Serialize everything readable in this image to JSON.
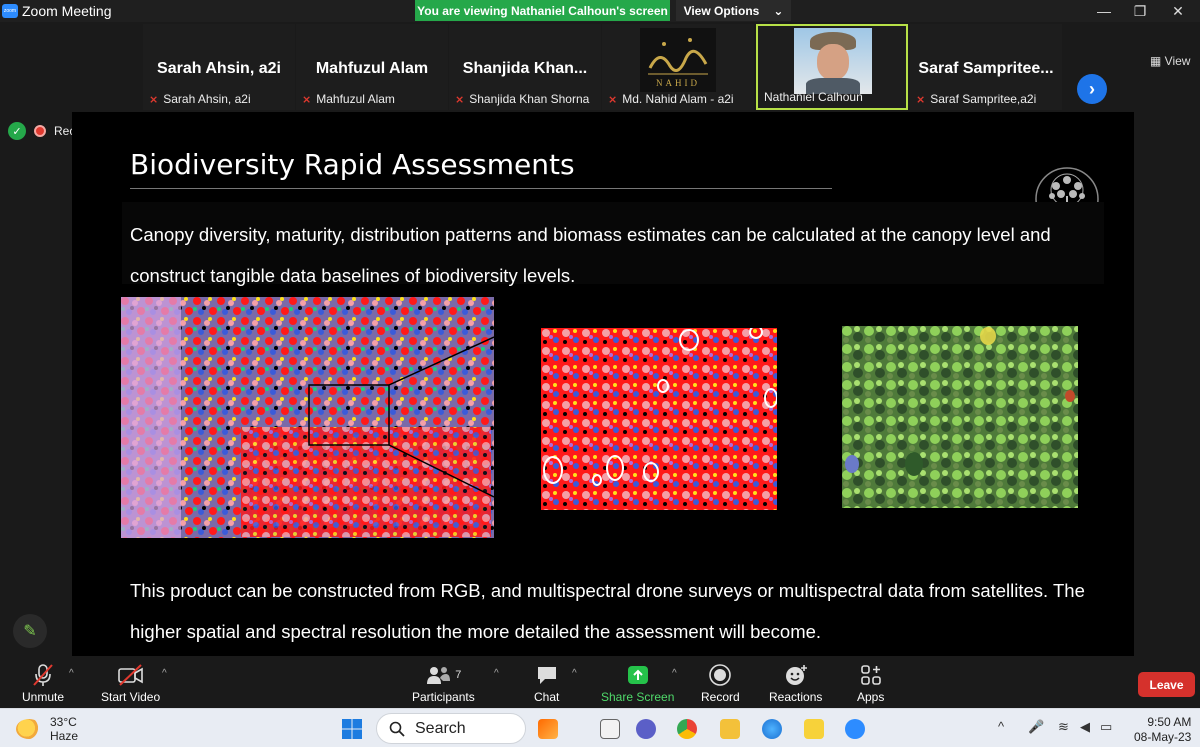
{
  "window": {
    "title": "Zoom Meeting",
    "banner": "You are viewing Nathaniel Calhoun's screen",
    "view_options": "View Options"
  },
  "gallery": {
    "view_label": "View",
    "participants": [
      {
        "display": "Sarah Ahsin, a2i",
        "name": "Sarah Ahsin, a2i",
        "muted": true
      },
      {
        "display": "Mahfuzul Alam",
        "name": "Mahfuzul Alam",
        "muted": true
      },
      {
        "display": "Shanjida  Khan...",
        "name": "Shanjida Khan Shorna",
        "muted": true
      },
      {
        "display": "",
        "name": "Md. Nahid Alam - a2i",
        "muted": true,
        "logo_caption": "NAHID"
      },
      {
        "display": "",
        "name": "Nathaniel Calhoun",
        "muted": false
      },
      {
        "display": "Saraf  Sampritee...",
        "name": "Saraf Sampritee,a2i",
        "muted": true
      }
    ]
  },
  "recording": {
    "label": "Recording"
  },
  "slide": {
    "title": "Biodiversity Rapid Assessments",
    "paragraph1": "Canopy diversity, maturity, distribution patterns and biomass estimates can be calculated at the canopy level and construct tangible data baselines of biodiversity levels.",
    "paragraph2": "This product can be constructed from RGB, and multispectral drone surveys or multispectral data from satellites. The higher spatial and spectral resolution the more detailed the assessment will become."
  },
  "toolbar": {
    "unmute": "Unmute",
    "start_video": "Start Video",
    "participants": "Participants",
    "participants_count": "7",
    "chat": "Chat",
    "share_screen": "Share Screen",
    "record": "Record",
    "reactions": "Reactions",
    "apps": "Apps",
    "leave": "Leave"
  },
  "taskbar": {
    "temperature": "33°C",
    "weather": "Haze",
    "search": "Search",
    "time": "9:50 AM",
    "date": "08-May-23"
  },
  "colors": {
    "banner_green": "#25a84a",
    "leave_red": "#d5312c",
    "active_border": "#b7e047",
    "next_blue": "#1e74e8"
  }
}
